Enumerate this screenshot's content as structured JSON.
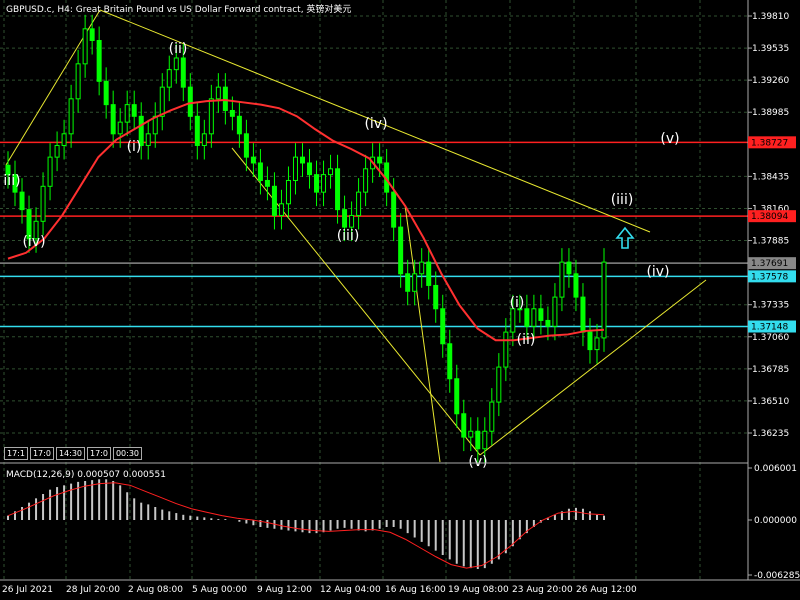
{
  "window": {
    "title": "GBPUSD.c, H4:  Great Britain Pound vs US Dollar Forward contract, 英镑对美元"
  },
  "chart_data": {
    "type": "candlestick",
    "symbol": "GBPUSD.c",
    "timeframe": "H4",
    "y_ticks": [
      "1.39810",
      "1.39535",
      "1.39260",
      "1.38985",
      "1.38435",
      "1.38160",
      "1.37885",
      "1.37335",
      "1.37060",
      "1.36785",
      "1.36510",
      "1.36235"
    ],
    "x_labels": [
      "26 Jul 2021",
      "28 Jul 20:00",
      "2 Aug 08:00",
      "5 Aug 00:00",
      "9 Aug 12:00",
      "12 Aug 04:00",
      "16 Aug 16:00",
      "19 Aug 08:00",
      "23 Aug 20:00",
      "26 Aug 12:00"
    ],
    "horizontal_levels": [
      {
        "price": "1.38727",
        "color": "#ff2020"
      },
      {
        "price": "1.38094",
        "color": "#ff2020"
      },
      {
        "price": "1.37691",
        "color": "#888888"
      },
      {
        "price": "1.37578",
        "color": "#33ddee"
      },
      {
        "price": "1.37148",
        "color": "#33ddee"
      }
    ],
    "wave_labels": [
      "(ii)",
      "(i)",
      "iii)",
      "(iv)",
      "(iii)",
      "(iv)",
      "(v)",
      "(i)",
      "(ii)",
      "(iii)",
      "(iv)",
      "(v)"
    ],
    "close_series": [
      1.3845,
      1.383,
      1.3815,
      1.379,
      1.3805,
      1.3835,
      1.386,
      1.387,
      1.388,
      1.391,
      1.394,
      1.397,
      1.396,
      1.3925,
      1.3905,
      1.388,
      1.389,
      1.3905,
      1.3895,
      1.387,
      1.388,
      1.3895,
      1.392,
      1.3935,
      1.3945,
      1.392,
      1.3895,
      1.387,
      1.388,
      1.391,
      1.392,
      1.39,
      1.3895,
      1.388,
      1.386,
      1.3855,
      1.384,
      1.3835,
      1.381,
      1.382,
      1.384,
      1.386,
      1.3855,
      1.3845,
      1.383,
      1.3845,
      1.385,
      1.3815,
      1.38,
      1.381,
      1.383,
      1.385,
      1.386,
      1.3855,
      1.383,
      1.38,
      1.376,
      1.3745,
      1.376,
      1.377,
      1.375,
      1.373,
      1.37,
      1.367,
      1.364,
      1.362,
      1.3625,
      1.361,
      1.3625,
      1.365,
      1.368,
      1.371,
      1.373,
      1.373,
      1.3715,
      1.373,
      1.372,
      1.3715,
      1.374,
      1.377,
      1.376,
      1.374,
      1.371,
      1.3695,
      1.3705,
      1.377
    ],
    "ma_series": [
      1.3773,
      1.3778,
      1.379,
      1.381,
      1.3835,
      1.386,
      1.3875,
      1.3884,
      1.3893,
      1.39,
      1.3906,
      1.3908,
      1.3909,
      1.3907,
      1.3905,
      1.3902,
      1.3895,
      1.3884,
      1.3874,
      1.3867,
      1.3859,
      1.384,
      1.3818,
      1.3791,
      1.376,
      1.3733,
      1.3713,
      1.3703,
      1.3703,
      1.3705,
      1.3707,
      1.3708,
      1.3711,
      1.3712
    ],
    "macd": {
      "label": "MACD(12,26,9) 0.000507 0.000551",
      "ticks": [
        "0.006001",
        "0.000000",
        "-0.006285"
      ],
      "hist": [
        0.0005,
        0.001,
        0.0015,
        0.002,
        0.0025,
        0.003,
        0.0035,
        0.0038,
        0.004,
        0.0042,
        0.0044,
        0.0045,
        0.0046,
        0.0047,
        0.0047,
        0.0045,
        0.004,
        0.0032,
        0.0025,
        0.002,
        0.0018,
        0.0015,
        0.0012,
        0.001,
        0.0008,
        0.0006,
        0.0005,
        0.0004,
        0.0003,
        0.0002,
        0.0001,
        0.0001,
        0.0,
        -0.0002,
        -0.0004,
        -0.0006,
        -0.0008,
        -0.0009,
        -0.001,
        -0.0011,
        -0.0012,
        -0.0013,
        -0.0014,
        -0.0015,
        -0.0015,
        -0.0014,
        -0.0012,
        -0.001,
        -0.0009,
        -0.001,
        -0.0012,
        -0.0013,
        -0.0012,
        -0.001,
        -0.0008,
        -0.0008,
        -0.001,
        -0.0015,
        -0.002,
        -0.0025,
        -0.003,
        -0.0035,
        -0.004,
        -0.0045,
        -0.005,
        -0.0053,
        -0.0055,
        -0.0056,
        -0.0055,
        -0.005,
        -0.0045,
        -0.0038,
        -0.003,
        -0.0022,
        -0.0015,
        -0.0008,
        -0.0003,
        0.0002,
        0.0006,
        0.001,
        0.0013,
        0.0014,
        0.0013,
        0.001,
        0.0006,
        0.0005
      ],
      "signal": [
        0.0005,
        0.0012,
        0.002,
        0.0028,
        0.0034,
        0.0039,
        0.0042,
        0.0043,
        0.004,
        0.0033,
        0.0026,
        0.0019,
        0.0013,
        0.0009,
        0.0005,
        0.0002,
        0.0,
        -0.0003,
        -0.0007,
        -0.001,
        -0.0012,
        -0.0013,
        -0.0012,
        -0.0011,
        -0.0011,
        -0.0014,
        -0.0022,
        -0.0032,
        -0.0042,
        -0.0051,
        -0.0055,
        -0.0052,
        -0.0042,
        -0.0028,
        -0.0012,
        0.0,
        0.0008,
        0.001,
        0.0007,
        0.0006
      ]
    }
  },
  "indicators_box": [
    "17:1",
    "17:0",
    "14:30",
    "17:0",
    "00:30"
  ],
  "colors": {
    "background": "#000000",
    "grid": "#2f4f2f",
    "candle_up": "#00ff00",
    "candle_down": "#00ff00",
    "ma": "#ff3030",
    "trendline": "#e8e830",
    "arrow": "#33ddee"
  },
  "arrow_icon": "up-arrow-icon"
}
